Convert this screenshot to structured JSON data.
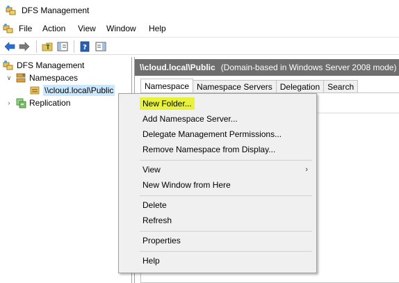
{
  "window": {
    "title": "DFS Management",
    "app_icon": "dfs-management-icon"
  },
  "menubar": {
    "items": [
      "File",
      "Action",
      "View",
      "Window",
      "Help"
    ]
  },
  "toolbar": {
    "buttons": [
      "back-icon",
      "forward-icon",
      "up-folder-icon",
      "show-hide-tree-icon",
      "help-icon",
      "show-hide-action-pane-icon"
    ]
  },
  "tree": {
    "root": "DFS Management",
    "namespaces": "Namespaces",
    "selected_namespace": "\\\\cloud.local\\Public",
    "replication": "Replication"
  },
  "details": {
    "header_path": "\\\\cloud.local\\Public",
    "header_type": "(Domain-based in Windows Server 2008 mode)",
    "tabs": [
      "Namespace",
      "Namespace Servers",
      "Delegation",
      "Search"
    ],
    "active_tab": "Namespace"
  },
  "context_menu": {
    "items": [
      {
        "label": "New Folder...",
        "highlight": true
      },
      {
        "label": "Add Namespace Server..."
      },
      {
        "label": "Delegate Management Permissions..."
      },
      {
        "label": "Remove Namespace from Display..."
      },
      {
        "label": "View",
        "submenu": true
      },
      {
        "label": "New Window from Here"
      },
      {
        "label": "Delete"
      },
      {
        "label": "Refresh"
      },
      {
        "label": "Properties"
      },
      {
        "label": "Help"
      }
    ],
    "highlight_color": "#e9f23b"
  }
}
